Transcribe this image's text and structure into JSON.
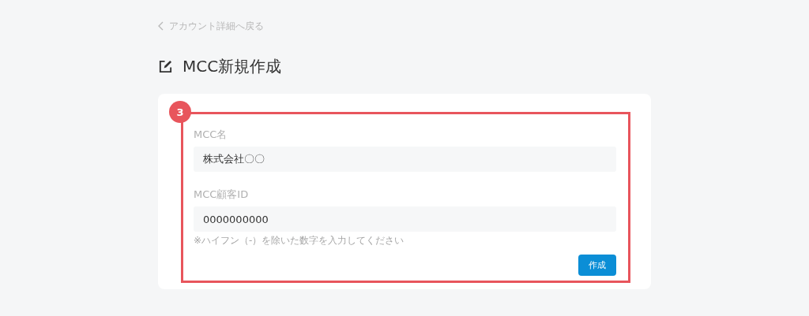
{
  "back_link": {
    "label": "アカウント詳細へ戻る"
  },
  "page_title": "MCC新規作成",
  "annotation": {
    "number": "3"
  },
  "form": {
    "fields": [
      {
        "label": "MCC名",
        "value": "株式会社〇〇"
      },
      {
        "label": "MCC顧客ID",
        "value": "0000000000",
        "hint": "※ハイフン（-）を除いた数字を入力してください"
      }
    ],
    "submit_button": "作成"
  }
}
